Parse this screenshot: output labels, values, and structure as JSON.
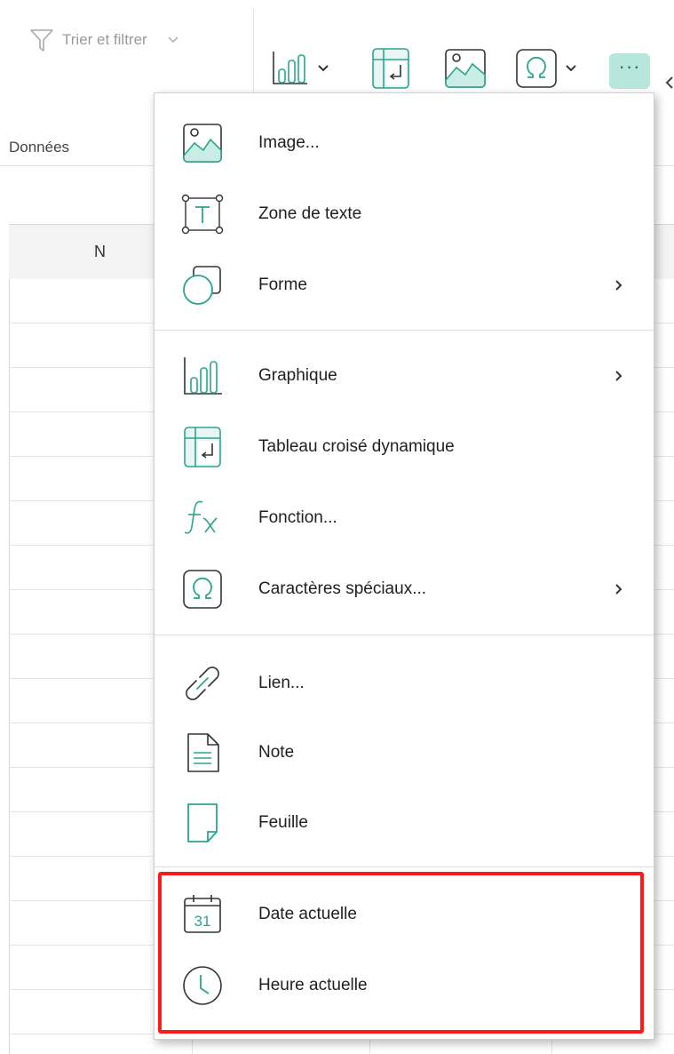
{
  "ribbon": {
    "sort_filter_label": "Trier et filtrer",
    "group_label": "Données",
    "more_label": "···"
  },
  "sheet": {
    "column_header": "N"
  },
  "menu": {
    "items": [
      {
        "label": "Image...",
        "icon": "image-icon"
      },
      {
        "label": "Zone de texte",
        "icon": "text-box-icon"
      },
      {
        "label": "Forme",
        "icon": "shape-icon",
        "submenu": true
      },
      {
        "label": "Graphique",
        "icon": "chart-icon",
        "submenu": true
      },
      {
        "label": "Tableau croisé dynamique",
        "icon": "pivot-table-icon"
      },
      {
        "label": "Fonction...",
        "icon": "function-icon"
      },
      {
        "label": "Caractères spéciaux...",
        "icon": "omega-icon",
        "submenu": true
      },
      {
        "label": "Lien...",
        "icon": "link-icon"
      },
      {
        "label": "Note",
        "icon": "note-icon"
      },
      {
        "label": "Feuille",
        "icon": "sheet-icon"
      },
      {
        "label": "Date actuelle",
        "icon": "calendar-icon"
      },
      {
        "label": "Heure actuelle",
        "icon": "clock-icon"
      }
    ],
    "calendar_day": "31"
  },
  "colors": {
    "accent": "#2aa58f",
    "more_button_bg": "#b7e6dc",
    "highlight": "#ff1a1a"
  }
}
